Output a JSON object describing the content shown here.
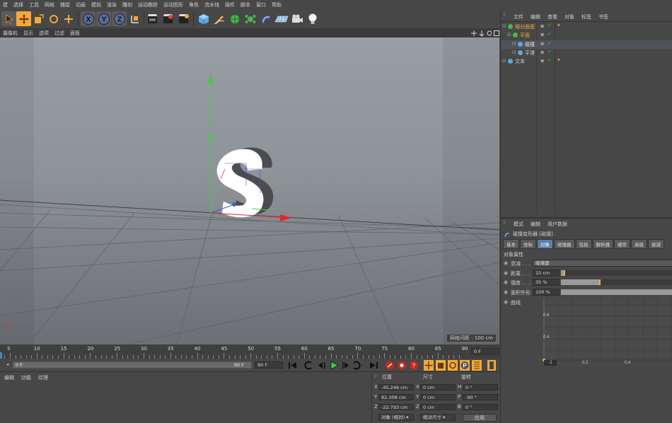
{
  "menu": [
    "建",
    "选择",
    "工具",
    "网格",
    "捕捉",
    "动画",
    "模拟",
    "渲染",
    "雕刻",
    "运动跟踪",
    "运动图形",
    "角色",
    "流水线",
    "插件",
    "脚本",
    "窗口",
    "帮助"
  ],
  "toolbar": {
    "icons": [
      "select-arrow",
      "move",
      "scale",
      "rotate",
      "add-object",
      "axis-x",
      "axis-y",
      "axis-z",
      "coordinate-system",
      "render-view",
      "render-picture",
      "render-settings",
      "cube",
      "pen",
      "subdivision",
      "cloner",
      "deformer",
      "floor",
      "camera",
      "light"
    ],
    "axis_labels": [
      "X",
      "Y",
      "Z"
    ]
  },
  "viewport": {
    "menu": [
      "摄像机",
      "显示",
      "选项",
      "过滤",
      "面板"
    ],
    "status": "网格间距 : 100 cm"
  },
  "timeline": {
    "ticks": [
      "5",
      "10",
      "15",
      "20",
      "25",
      "30",
      "35",
      "40",
      "45",
      "50",
      "55",
      "60",
      "65",
      "70",
      "75",
      "80",
      "85",
      "90"
    ],
    "current_frame": "0 F",
    "range_start": "0 F",
    "range_end": "90 F",
    "max_frame": "90 F",
    "left_frame": "0 F"
  },
  "materials": {
    "menu": [
      "编辑",
      "功能",
      "纹理"
    ]
  },
  "coords": {
    "headers": [
      "位置",
      "尺寸",
      "旋转"
    ],
    "rows": [
      {
        "axis": "X",
        "pos": "-45.246 cm",
        "size_axis": "X",
        "size": "0 cm",
        "rot_axis": "H",
        "rot": "0 °"
      },
      {
        "axis": "Y",
        "pos": "82.308 cm",
        "size_axis": "Y",
        "size": "0 cm",
        "rot_axis": "P",
        "rot": "-90 °"
      },
      {
        "axis": "Z",
        "pos": "-22.793 cm",
        "size_axis": "Z",
        "size": "0 cm",
        "rot_axis": "B",
        "rot": "0 °"
      }
    ],
    "mode_select": "对象 (相对)",
    "size_select": "绝对尺寸",
    "apply_button": "应用"
  },
  "objects": {
    "menu": [
      "文件",
      "编辑",
      "查看",
      "对象",
      "标签",
      "书签"
    ],
    "items": [
      {
        "name": "细分曲面",
        "indent": 0,
        "color": "#f2a93a",
        "selected": false,
        "tag": true
      },
      {
        "name": "平面",
        "indent": 1,
        "color": "#f2a93a",
        "selected": false,
        "tag": false
      },
      {
        "name": "碰撞",
        "indent": 2,
        "color": "#e8e8e8",
        "selected": true,
        "tag": false
      },
      {
        "name": "平滑",
        "indent": 2,
        "color": "#cfcfcf",
        "selected": false,
        "tag": false
      },
      {
        "name": "文本",
        "indent": 0,
        "color": "#cfcfcf",
        "selected": false,
        "tag": true
      }
    ]
  },
  "attributes": {
    "menu": [
      "模式",
      "编辑",
      "用户数据"
    ],
    "title": "碰撞变形器 [碰撞]",
    "tabs": [
      "基本",
      "坐标",
      "对象",
      "碰撞器",
      "包括",
      "解析器",
      "缓存",
      "高级",
      "衰减"
    ],
    "active_tab": "对象",
    "section": "对象属性",
    "props": [
      {
        "label": "衰减 . . .",
        "value": "碰撞器",
        "type": "select"
      },
      {
        "label": "距离 . . .",
        "value": "15 cm",
        "type": "slider",
        "fraction": 0.03
      },
      {
        "label": "强度 . . .",
        "value": "35 %",
        "type": "slider",
        "fraction": 0.35
      },
      {
        "label": "面积外形",
        "value": "100 %",
        "type": "slider",
        "fraction": 1.0
      },
      {
        "label": "曲线",
        "value": "",
        "type": "curve"
      }
    ],
    "curve_y_ticks": [
      "0.6",
      "0.4"
    ],
    "curve_x_ticks": [
      "0.2",
      "0.4"
    ],
    "curve_corner": "-1"
  },
  "colors": {
    "accent": "#f2a93a",
    "active_tab": "#5b7ea8",
    "x_axis": "#e0282a",
    "y_axis": "#3ad13a",
    "z_axis": "#3a5ee0"
  }
}
